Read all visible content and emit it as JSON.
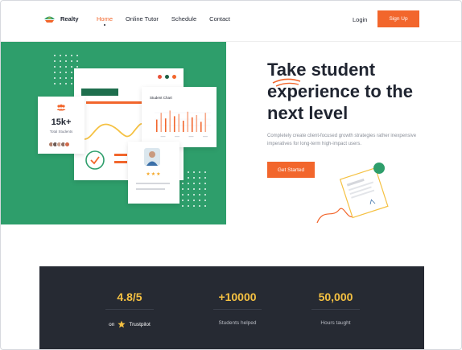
{
  "brand": {
    "name": "Realty",
    "accent": "#f2662c",
    "green": "#2e9e6b",
    "dark": "#262a33",
    "gold": "#f5c142"
  },
  "nav": {
    "items": [
      {
        "label": "Home",
        "active": true
      },
      {
        "label": "Online Tutor"
      },
      {
        "label": "Schedule"
      },
      {
        "label": "Contact"
      }
    ],
    "login_label": "Login",
    "signup_label": "Sign Up"
  },
  "hero": {
    "title_line1": "Take student",
    "title_line2": "experience to the",
    "title_line3": "next level",
    "subtitle": "Completely create client-focused growth strategies rather inexpensive imperatives for long-term high-impact users.",
    "cta_label": "Get Started"
  },
  "illustration": {
    "stats_value": "15k+",
    "stats_label": "Total Students",
    "chart_title": "Student Chart",
    "chart_values": [
      0.55,
      0.85,
      0.6,
      0.95,
      0.7,
      0.8,
      0.5,
      0.9,
      0.65,
      0.75,
      0.45,
      0.85
    ],
    "rating_stars": "★★★"
  },
  "stats": [
    {
      "value": "4.8/5",
      "label_prefix": "on",
      "label": "Trustpilot",
      "icon": "star-icon"
    },
    {
      "value": "+10000",
      "label": "Students helped"
    },
    {
      "value": "50,000",
      "label": "Hours taught"
    }
  ]
}
